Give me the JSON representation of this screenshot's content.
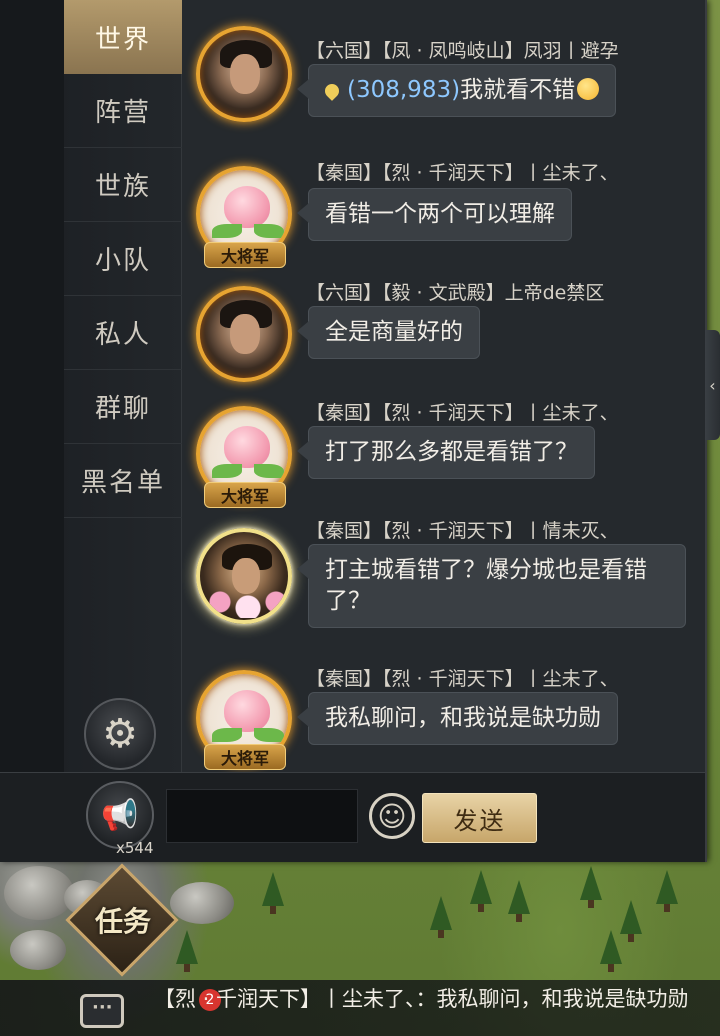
{
  "tabs": [
    {
      "label": "世界",
      "active": true
    },
    {
      "label": "阵营",
      "active": false
    },
    {
      "label": "世族",
      "active": false
    },
    {
      "label": "小队",
      "active": false
    },
    {
      "label": "私人",
      "active": false
    },
    {
      "label": "群聊",
      "active": false
    },
    {
      "label": "黑名单",
      "active": false
    }
  ],
  "messages": [
    {
      "header": "【六国】【凤 · 凤鸣岐山】凤羽丨避孕",
      "text_before": "",
      "coord": "(308,983)",
      "text": "我就看不错",
      "has_emoji": true,
      "avatar": "warrior-icon",
      "badge": ""
    },
    {
      "header": "【秦国】【烈 · 千润天下】丨尘未了、",
      "text": "看错一个两个可以理解",
      "avatar": "peach-icon",
      "badge": "大将军"
    },
    {
      "header": "【六国】【毅 · 文武殿】上帝de禁区",
      "text": "全是商量好的",
      "avatar": "warrior-icon",
      "badge": ""
    },
    {
      "header": "【秦国】【烈 · 千润天下】丨尘未了、",
      "text": "打了那么多都是看错了？",
      "avatar": "peach-icon",
      "badge": "大将军"
    },
    {
      "header": "【秦国】【烈 · 千润天下】丨情未灭、",
      "text": "打主城看错了？爆分城也是看错了？",
      "avatar": "crown-icon",
      "badge": ""
    },
    {
      "header": "【秦国】【烈 · 千润天下】丨尘未了、",
      "text": "我私聊问，和我说是缺功勋",
      "avatar": "peach-icon",
      "badge": "大将军"
    }
  ],
  "input": {
    "placeholder": "",
    "value": ""
  },
  "horn_count": "x544",
  "send_label": "发送",
  "task_label": "任务",
  "ticker": {
    "count": "2",
    "text": "【烈 · 千润天下】丨尘未了、：我私聊问，和我说是缺功勋"
  },
  "colors": {
    "accent_gold": "#c7a66a",
    "coord_blue": "#8ec8ff",
    "badge_red": "#d8352f"
  }
}
